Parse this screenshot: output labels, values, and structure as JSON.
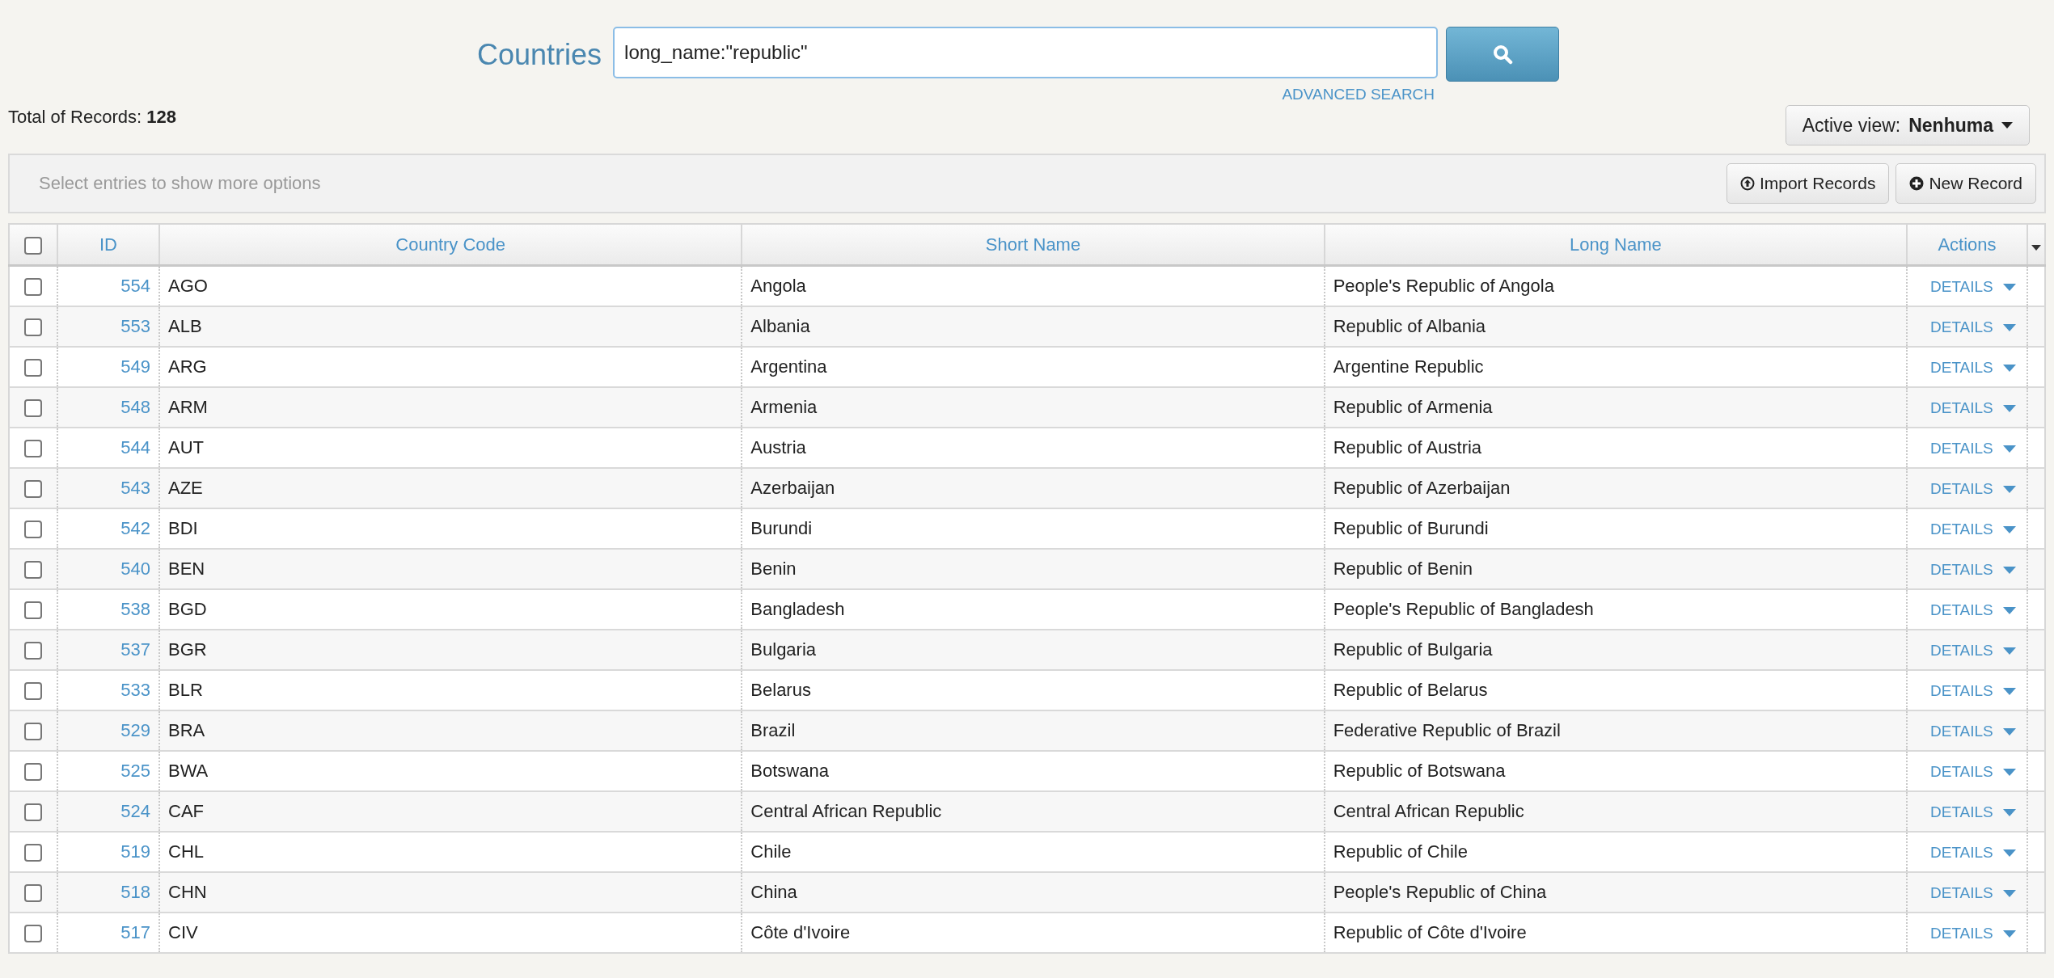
{
  "search": {
    "label": "Countries",
    "value": "long_name:\"republic\"",
    "advanced_link": "ADVANCED SEARCH"
  },
  "total": {
    "label": "Total of Records:",
    "count": "128"
  },
  "active_view": {
    "label": "Active view:",
    "value": "Nenhuma"
  },
  "toolbar": {
    "hint": "Select entries to show more options",
    "buttons": [
      {
        "kind": "import",
        "label": "Import Records"
      },
      {
        "kind": "new",
        "label": "New Record"
      }
    ]
  },
  "table": {
    "select_all": {
      "checked": false
    },
    "columns": [
      "ID",
      "Country Code",
      "Short Name",
      "Long Name",
      "Actions"
    ],
    "rows": [
      {
        "checked": false,
        "id": "554",
        "code": "AGO",
        "short": "Angola",
        "long": "People's Republic of Angola",
        "action": "DETAILS"
      },
      {
        "checked": false,
        "id": "553",
        "code": "ALB",
        "short": "Albania",
        "long": "Republic of Albania",
        "action": "DETAILS"
      },
      {
        "checked": false,
        "id": "549",
        "code": "ARG",
        "short": "Argentina",
        "long": "Argentine Republic",
        "action": "DETAILS"
      },
      {
        "checked": false,
        "id": "548",
        "code": "ARM",
        "short": "Armenia",
        "long": "Republic of Armenia",
        "action": "DETAILS"
      },
      {
        "checked": false,
        "id": "544",
        "code": "AUT",
        "short": "Austria",
        "long": "Republic of Austria",
        "action": "DETAILS"
      },
      {
        "checked": false,
        "id": "543",
        "code": "AZE",
        "short": "Azerbaijan",
        "long": "Republic of Azerbaijan",
        "action": "DETAILS"
      },
      {
        "checked": false,
        "id": "542",
        "code": "BDI",
        "short": "Burundi",
        "long": "Republic of Burundi",
        "action": "DETAILS"
      },
      {
        "checked": false,
        "id": "540",
        "code": "BEN",
        "short": "Benin",
        "long": "Republic of Benin",
        "action": "DETAILS"
      },
      {
        "checked": false,
        "id": "538",
        "code": "BGD",
        "short": "Bangladesh",
        "long": "People's Republic of Bangladesh",
        "action": "DETAILS"
      },
      {
        "checked": false,
        "id": "537",
        "code": "BGR",
        "short": "Bulgaria",
        "long": "Republic of Bulgaria",
        "action": "DETAILS"
      },
      {
        "checked": false,
        "id": "533",
        "code": "BLR",
        "short": "Belarus",
        "long": "Republic of Belarus",
        "action": "DETAILS"
      },
      {
        "checked": false,
        "id": "529",
        "code": "BRA",
        "short": "Brazil",
        "long": "Federative Republic of Brazil",
        "action": "DETAILS"
      },
      {
        "checked": false,
        "id": "525",
        "code": "BWA",
        "short": "Botswana",
        "long": "Republic of Botswana",
        "action": "DETAILS"
      },
      {
        "checked": false,
        "id": "524",
        "code": "CAF",
        "short": "Central African Republic",
        "long": "Central African Republic",
        "action": "DETAILS"
      },
      {
        "checked": false,
        "id": "519",
        "code": "CHL",
        "short": "Chile",
        "long": "Republic of Chile",
        "action": "DETAILS"
      },
      {
        "checked": false,
        "id": "518",
        "code": "CHN",
        "short": "China",
        "long": "People's Republic of China",
        "action": "DETAILS"
      },
      {
        "checked": false,
        "id": "517",
        "code": "CIV",
        "short": "Côte d'Ivoire",
        "long": "Republic of Côte d'Ivoire",
        "action": "DETAILS"
      }
    ]
  }
}
